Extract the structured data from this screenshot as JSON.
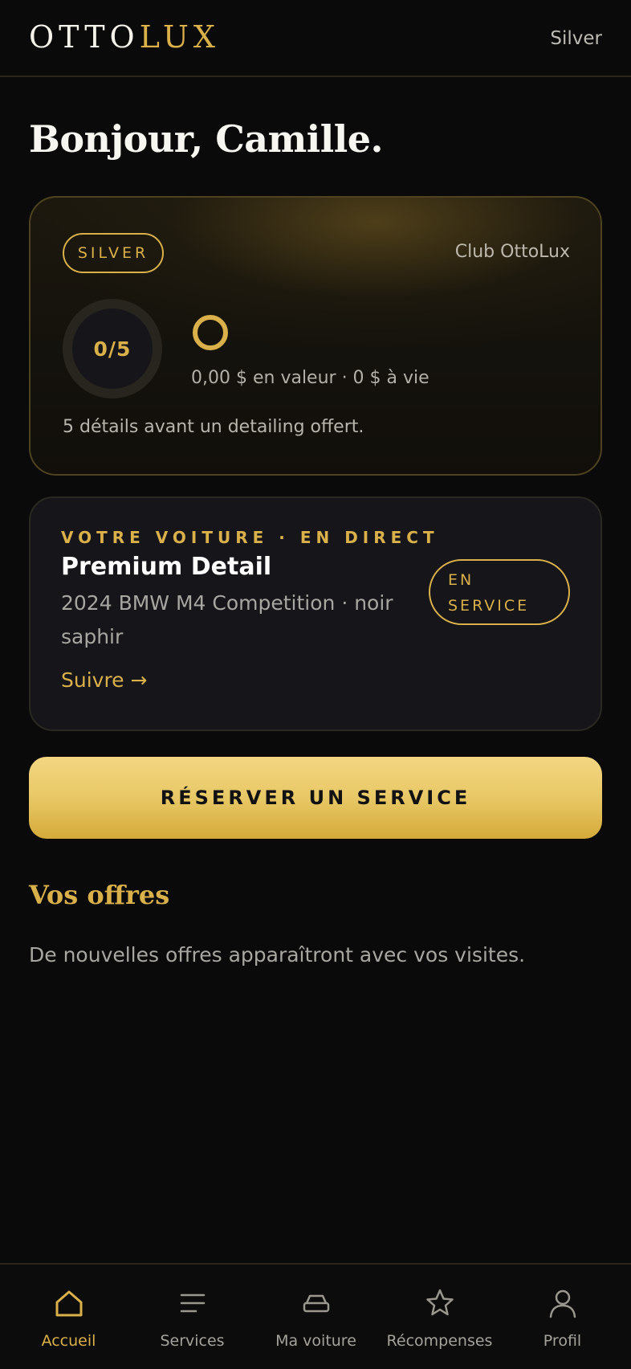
{
  "header": {
    "logo_part1": "OTTO",
    "logo_part2": "LUX",
    "tier": "Silver"
  },
  "greeting": "Bonjour, Camille.",
  "loyalty": {
    "badge": "SILVER",
    "club": "Club OttoLux",
    "progress_text": "0/5",
    "progress_value": 0,
    "progress_goal": 5,
    "value_line": "0,00 $ en valeur · 0 $ à vie",
    "note": "5 détails avant un detailing offert."
  },
  "live_car": {
    "eyebrow": "VOTRE VOITURE · EN DIRECT",
    "title": "Premium Detail",
    "car": "2024 BMW M4 Competition · noir saphir",
    "follow": "Suivre →",
    "status_line1": "EN",
    "status_line2": "SERVICE"
  },
  "cta": {
    "label": "RÉSERVER UN SERVICE"
  },
  "offers": {
    "title": "Vos offres",
    "empty": "De nouvelles offres apparaîtront avec vos visites."
  },
  "nav": {
    "items": [
      {
        "label": "Accueil",
        "icon": "home-icon",
        "active": true
      },
      {
        "label": "Services",
        "icon": "list-icon",
        "active": false
      },
      {
        "label": "Ma voiture",
        "icon": "car-icon",
        "active": false
      },
      {
        "label": "Récompenses",
        "icon": "star-icon",
        "active": false
      },
      {
        "label": "Profil",
        "icon": "user-icon",
        "active": false
      }
    ]
  },
  "colors": {
    "background": "#0a0a0a",
    "accent_gold": "#d9b04a",
    "card": "#16151a",
    "muted_text": "#a8a6a1"
  }
}
